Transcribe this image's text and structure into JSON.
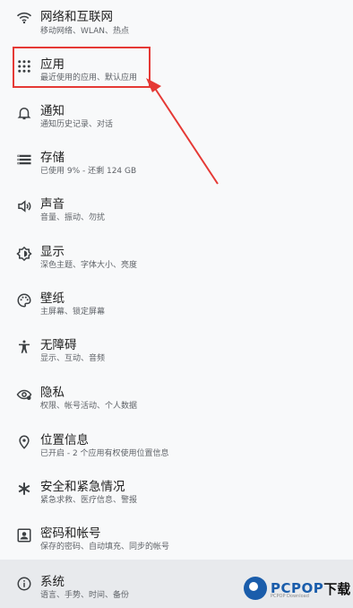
{
  "settings": [
    {
      "title": "网络和互联网",
      "subtitle": "移动网络、WLAN、热点",
      "icon": "wifi-icon"
    },
    {
      "title": "应用",
      "subtitle": "最近使用的应用、默认应用",
      "icon": "apps-grid-icon"
    },
    {
      "title": "通知",
      "subtitle": "通知历史记录、对话",
      "icon": "bell-icon"
    },
    {
      "title": "存储",
      "subtitle": "已使用 9% - 还剩 124 GB",
      "icon": "storage-icon"
    },
    {
      "title": "声音",
      "subtitle": "音量、振动、勿扰",
      "icon": "volume-icon"
    },
    {
      "title": "显示",
      "subtitle": "深色主题、字体大小、亮度",
      "icon": "brightness-icon"
    },
    {
      "title": "壁纸",
      "subtitle": "主屏幕、锁定屏幕",
      "icon": "palette-icon"
    },
    {
      "title": "无障碍",
      "subtitle": "显示、互动、音频",
      "icon": "accessibility-icon"
    },
    {
      "title": "隐私",
      "subtitle": "权限、帐号活动、个人数据",
      "icon": "eye-icon"
    },
    {
      "title": "位置信息",
      "subtitle": "已开启 - 2 个应用有权使用位置信息",
      "icon": "location-pin-icon"
    },
    {
      "title": "安全和紧急情况",
      "subtitle": "紧急求救、医疗信息、警报",
      "icon": "asterisk-icon"
    },
    {
      "title": "密码和帐号",
      "subtitle": "保存的密码、自动填充、同步的帐号",
      "icon": "account-box-icon"
    },
    {
      "title": "系统",
      "subtitle": "语言、手势、时间、备份",
      "icon": "info-icon"
    }
  ],
  "watermark": {
    "brand": "PCPOP",
    "suffix": "下载",
    "tagline": "PCPOP Download"
  },
  "colors": {
    "highlight": "#e53935",
    "selected_bg": "#e8eaed",
    "brand": "#1a5dab"
  }
}
